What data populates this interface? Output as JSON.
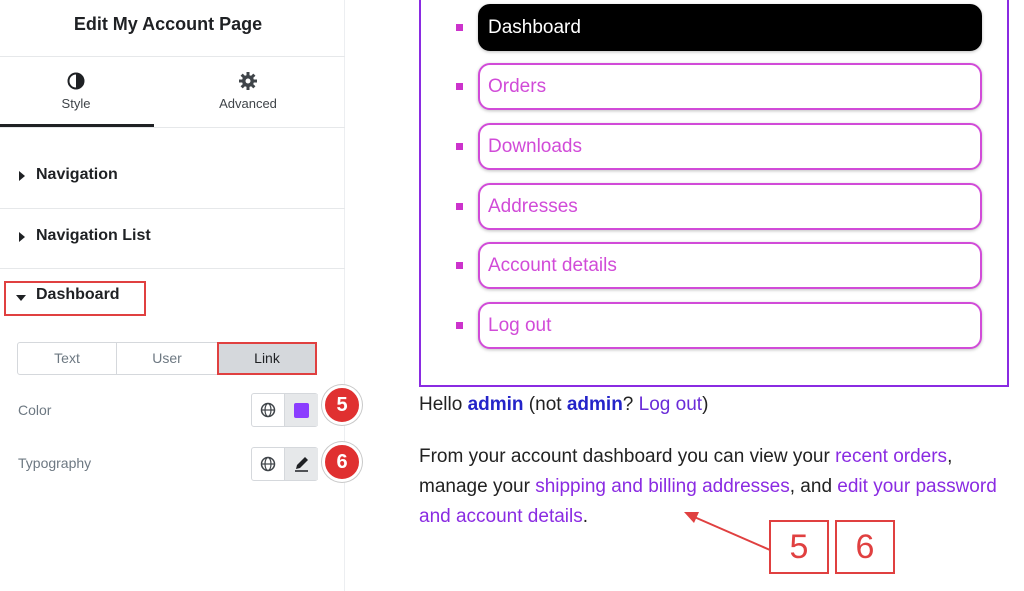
{
  "panel": {
    "title": "Edit My Account Page",
    "tabs": [
      {
        "label": "Style",
        "icon": "contrast-icon",
        "active": true
      },
      {
        "label": "Advanced",
        "icon": "gear-icon",
        "active": false
      }
    ],
    "sections": [
      {
        "label": "Navigation",
        "expanded": false
      },
      {
        "label": "Navigation List",
        "expanded": false
      },
      {
        "label": "Dashboard",
        "expanded": true
      }
    ],
    "segmented": [
      {
        "label": "Text",
        "active": false
      },
      {
        "label": "User",
        "active": false
      },
      {
        "label": "Link",
        "active": true
      }
    ],
    "controls": {
      "color_label": "Color",
      "color_value": "#8b3dff",
      "typography_label": "Typography"
    },
    "badges": [
      "5",
      "6"
    ]
  },
  "preview": {
    "nav_items": [
      {
        "label": "Dashboard",
        "active": true
      },
      {
        "label": "Orders",
        "active": false
      },
      {
        "label": "Downloads",
        "active": false
      },
      {
        "label": "Addresses",
        "active": false
      },
      {
        "label": "Account details",
        "active": false
      },
      {
        "label": "Log out",
        "active": false
      }
    ],
    "hello": {
      "prefix": "Hello ",
      "user": "admin",
      "mid": " (not ",
      "user2": "admin",
      "q": "? ",
      "logout": "Log out",
      "suffix": ")"
    },
    "paragraph": {
      "t1": "From your account dashboard you can view your ",
      "l1": "recent orders",
      "t2": ", manage your ",
      "l2": "shipping and billing addresses",
      "t3": ", and ",
      "l3": "edit your password and account details",
      "t4": "."
    },
    "callouts": [
      "5",
      "6"
    ]
  },
  "colors": {
    "accent_purple": "#8a2be2",
    "pill_magenta": "#d14bd8",
    "annotation_red": "#e04040"
  }
}
